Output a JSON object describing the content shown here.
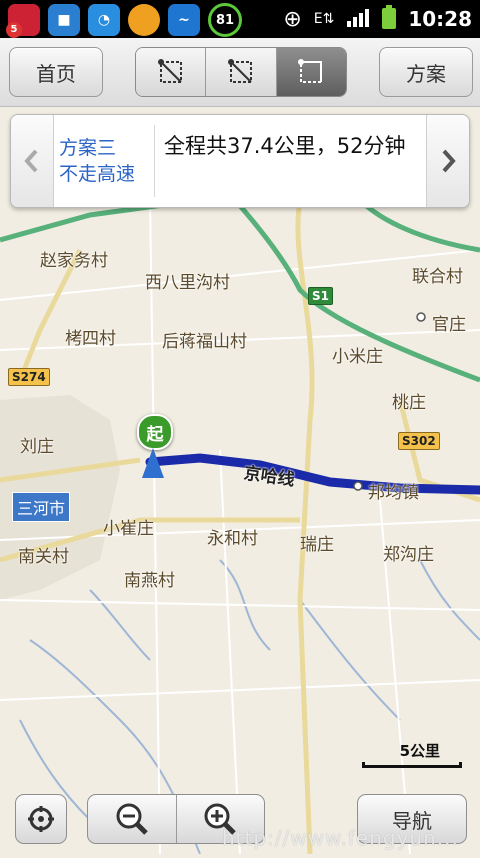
{
  "status_bar": {
    "time": "10:28",
    "notification_badge": "5",
    "icons": [
      "weibo-icon",
      "bbm-icon",
      "qq-icon",
      "sun-icon",
      "bird-icon",
      "battery-percent-icon"
    ],
    "battery_percent_text": "81"
  },
  "toolbar": {
    "home_label": "首页",
    "plans_label": "方案",
    "modes": [
      "route-mode-1-icon",
      "route-mode-2-icon",
      "route-mode-3-icon"
    ],
    "active_mode_index": 2
  },
  "route_panel": {
    "plan_name": "方案三",
    "plan_option": "不走高速",
    "summary": "全程共37.4公里，52分钟"
  },
  "map": {
    "places": [
      {
        "name": "赵家务村"
      },
      {
        "name": "西八里沟村"
      },
      {
        "name": "联合村"
      },
      {
        "name": "官庄"
      },
      {
        "name": "栲四村"
      },
      {
        "name": "后蒋福山村"
      },
      {
        "name": "小米庄"
      },
      {
        "name": "桃庄"
      },
      {
        "name": "刘庄"
      },
      {
        "name": "邦均镇"
      },
      {
        "name": "小崔庄"
      },
      {
        "name": "永和村"
      },
      {
        "name": "瑞庄"
      },
      {
        "name": "郑沟庄"
      },
      {
        "name": "南关村"
      },
      {
        "name": "南燕村"
      }
    ],
    "city_label": "三河市",
    "road_label": "京哈线",
    "shields": {
      "s1": "S1",
      "s274": "S274",
      "s302": "S302"
    },
    "start_marker": "起"
  },
  "scale": {
    "text": "5公里"
  },
  "bottom": {
    "navigate_label": "导航",
    "watermark": "http://www.fengyun..."
  },
  "colors": {
    "route": "#1a2aa8",
    "map_bg": "#f1ede2",
    "road_green": "#58b07a",
    "road_yellow": "#e9d99a",
    "accent_blue": "#2b64c8"
  }
}
